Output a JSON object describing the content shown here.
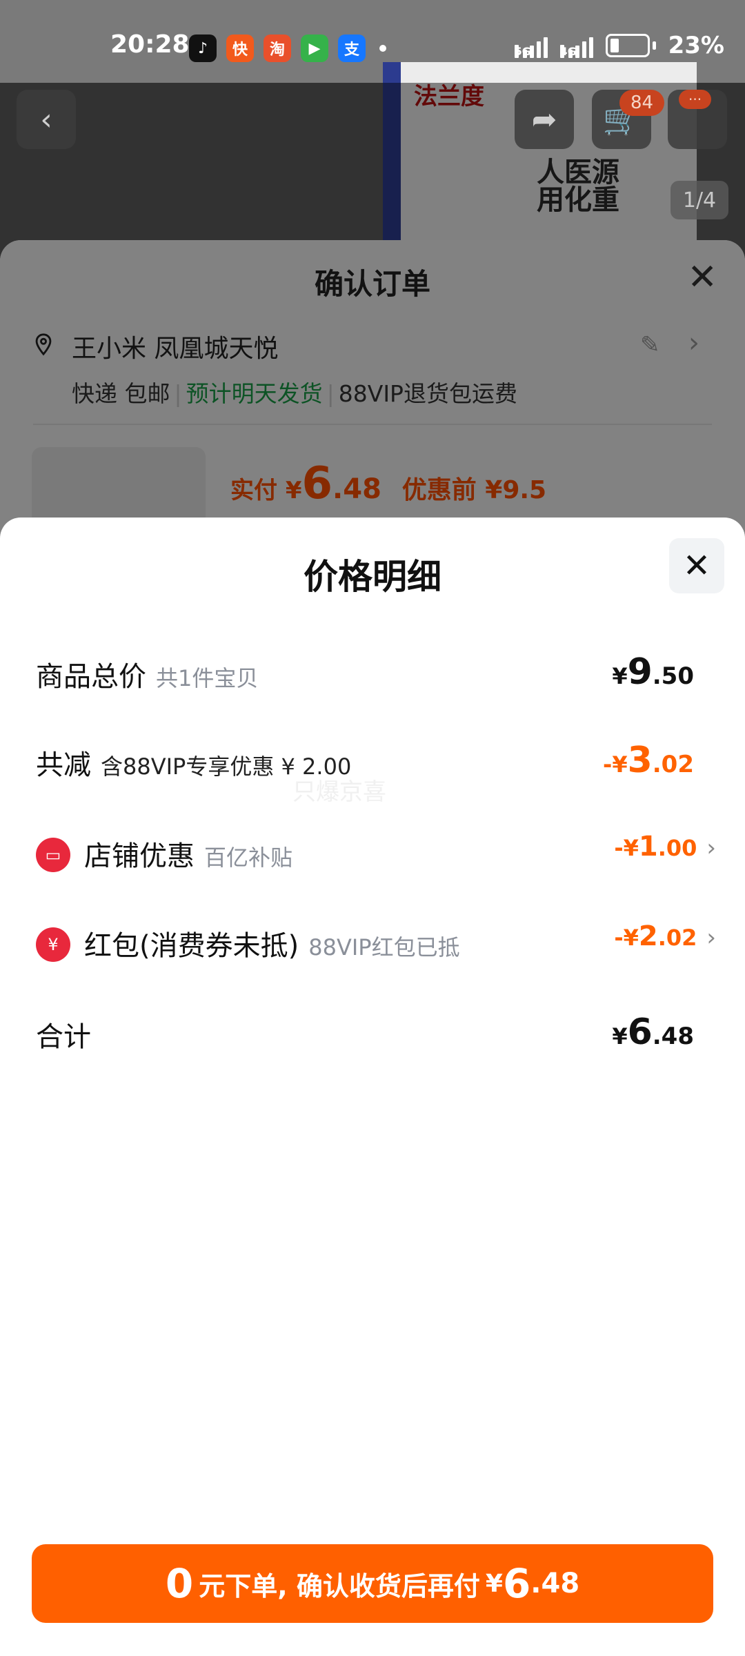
{
  "status_bar": {
    "time": "20:28",
    "network_1": "5G",
    "network_2": "4G",
    "battery": "23%",
    "app_icons": [
      "douyin-icon",
      "kuaishou-icon",
      "taobao-icon",
      "video-icon",
      "alipay-icon"
    ],
    "app_glyphs": [
      "♪",
      "快",
      "淘",
      "▶",
      "支"
    ]
  },
  "product_page": {
    "brand": "法兰度",
    "image_text": "人医源用化重",
    "cart_badge": "84",
    "more_badge": "···",
    "page_indicator": "1/4"
  },
  "order": {
    "title": "确认订单",
    "close": "✕",
    "address": "王小米 凤凰城天悦",
    "shipping": "快递 包邮",
    "delivery": "预计明天发货",
    "return_policy": "88VIP退货包运费",
    "pay_label": "实付",
    "pay_symbol": "¥",
    "pay_int": "6",
    "pay_dec": ".48",
    "pre_discount": "优惠前 ¥9.5"
  },
  "price_detail": {
    "title": "价格明细",
    "close": "✕",
    "rows": [
      {
        "label": "商品总价",
        "sub": "共1件宝贝",
        "sym": "¥",
        "int": "9",
        "dec": ".50"
      },
      {
        "label": "共减",
        "sub": "含88VIP专享优惠 ¥ 2.00",
        "sym": "-¥",
        "int": "3",
        "dec": ".02"
      },
      {
        "label": "店铺优惠",
        "sub": "百亿补贴",
        "sym": "-¥",
        "int": "1",
        "dec": ".00"
      },
      {
        "label": "红包(消费券未抵)",
        "sub": "88VIP红包已抵",
        "sym": "-¥",
        "int": "2",
        "dec": ".02"
      },
      {
        "label": "合计",
        "sub": "",
        "sym": "¥",
        "int": "6",
        "dec": ".48"
      }
    ],
    "watermark": "只爆京喜"
  },
  "cta": {
    "zero": "0",
    "text": "元下单, 确认收货后再付",
    "sym": "¥",
    "int": "6",
    "dec": ".48"
  },
  "colors": {
    "accent": "#ff6000",
    "discount": "#ff6200",
    "delivery_green": "#1a9e46",
    "coupon_red": "#e8283c"
  }
}
